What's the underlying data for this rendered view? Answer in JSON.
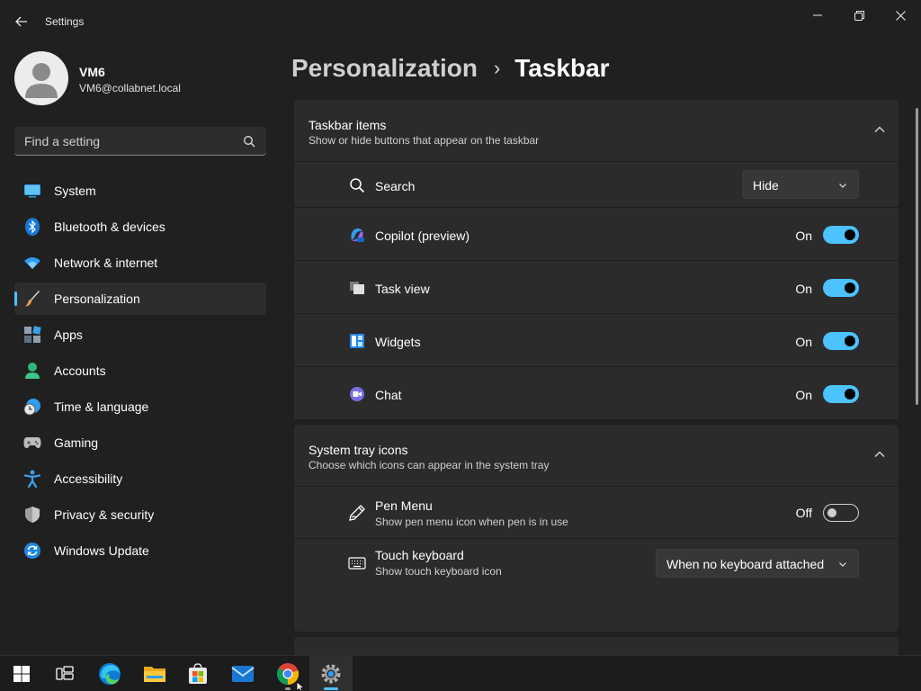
{
  "window": {
    "title": "Settings",
    "controls": {
      "minimize": "—",
      "maximize": "❐",
      "close": "✕"
    }
  },
  "user": {
    "name": "VM6",
    "email": "VM6@collabnet.local"
  },
  "search": {
    "placeholder": "Find a setting"
  },
  "sidebar": {
    "items": [
      {
        "label": "System",
        "icon": "system-icon"
      },
      {
        "label": "Bluetooth & devices",
        "icon": "bluetooth-icon"
      },
      {
        "label": "Network & internet",
        "icon": "wifi-icon"
      },
      {
        "label": "Personalization",
        "icon": "brush-icon",
        "selected": true
      },
      {
        "label": "Apps",
        "icon": "apps-icon"
      },
      {
        "label": "Accounts",
        "icon": "accounts-icon"
      },
      {
        "label": "Time & language",
        "icon": "clock-globe-icon"
      },
      {
        "label": "Gaming",
        "icon": "gamepad-icon"
      },
      {
        "label": "Accessibility",
        "icon": "accessibility-icon"
      },
      {
        "label": "Privacy & security",
        "icon": "shield-icon"
      },
      {
        "label": "Windows Update",
        "icon": "update-icon"
      }
    ]
  },
  "breadcrumb": {
    "parent": "Personalization",
    "separator": "›",
    "current": "Taskbar"
  },
  "sections": {
    "taskbar_items": {
      "title": "Taskbar items",
      "subtitle": "Show or hide buttons that appear on the taskbar",
      "rows": {
        "search": {
          "label": "Search",
          "value": "Hide",
          "icon": "search-icon"
        },
        "copilot": {
          "label": "Copilot (preview)",
          "state": "On",
          "on": true,
          "icon": "copilot-icon"
        },
        "task_view": {
          "label": "Task view",
          "state": "On",
          "on": true,
          "icon": "task-view-icon"
        },
        "widgets": {
          "label": "Widgets",
          "state": "On",
          "on": true,
          "icon": "widgets-icon"
        },
        "chat": {
          "label": "Chat",
          "state": "On",
          "on": true,
          "icon": "chat-icon"
        }
      }
    },
    "system_tray": {
      "title": "System tray icons",
      "subtitle": "Choose which icons can appear in the system tray",
      "rows": {
        "pen_menu": {
          "label": "Pen Menu",
          "subtitle": "Show pen menu icon when pen is in use",
          "state": "Off",
          "on": false,
          "icon": "pen-icon"
        },
        "touch_keyboard": {
          "label": "Touch keyboard",
          "subtitle": "Show touch keyboard icon",
          "value": "When no keyboard attached",
          "icon": "keyboard-icon"
        }
      }
    }
  },
  "taskbar": {
    "items": [
      {
        "name": "start-button",
        "icon": "windows-logo-icon"
      },
      {
        "name": "task-view-button",
        "icon": "task-view-icon"
      },
      {
        "name": "edge-button",
        "icon": "edge-icon"
      },
      {
        "name": "file-explorer-button",
        "icon": "folder-icon"
      },
      {
        "name": "store-button",
        "icon": "store-icon"
      },
      {
        "name": "mail-button",
        "icon": "mail-icon"
      },
      {
        "name": "chrome-button",
        "icon": "chrome-icon",
        "state": "running"
      },
      {
        "name": "settings-button",
        "icon": "settings-gear-icon",
        "state": "active"
      }
    ]
  },
  "colors": {
    "accent": "#4cc2ff",
    "background": "#202020",
    "card": "#2b2b2b"
  }
}
